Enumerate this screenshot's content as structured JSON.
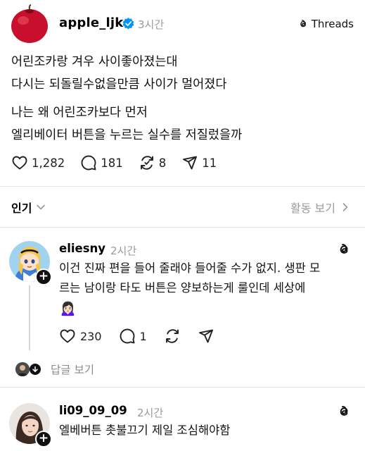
{
  "post": {
    "username": "apple_ljk",
    "time": "3시간",
    "threads_label": "Threads",
    "lines": [
      "어린조카랑 겨우 사이좋아졌는대",
      "다시는 되돌릴수없을만큼 사이가 멀어졌다",
      "나는 왜 어린조카보다 먼저",
      "엘리베이터 버튼을 누르는 실수를 저질렀을까"
    ],
    "counts": {
      "likes": "1,282",
      "comments": "181",
      "reposts": "8",
      "shares": "11"
    }
  },
  "sort": {
    "label": "인기",
    "activity_label": "활동 보기"
  },
  "replies": [
    {
      "username": "eliesny",
      "time": "2시간",
      "lines": [
        "이건 진짜 편을 들어 줄래야 들어줄 수가 없지. 생판 모",
        "르는 남이랑 타도 버튼은 양보하는게 룰인데 세상에",
        "🙍🏻‍♀️"
      ],
      "counts": {
        "likes": "230",
        "comments": "1"
      },
      "more_label": "답글 보기"
    },
    {
      "username": "li09_09_09",
      "time": "2시간",
      "lines": [
        "엘베버튼 촛불끄기 제일 조심해야함"
      ]
    }
  ],
  "icons": {
    "verified": "verified-badge-icon",
    "threads": "threads-logo-icon",
    "like": "heart-icon",
    "comment": "comment-icon",
    "repost": "repost-icon",
    "share": "share-icon"
  },
  "colors": {
    "verified": "#0095f6",
    "muted": "#9a9a9a",
    "apple": "#c8102e"
  }
}
